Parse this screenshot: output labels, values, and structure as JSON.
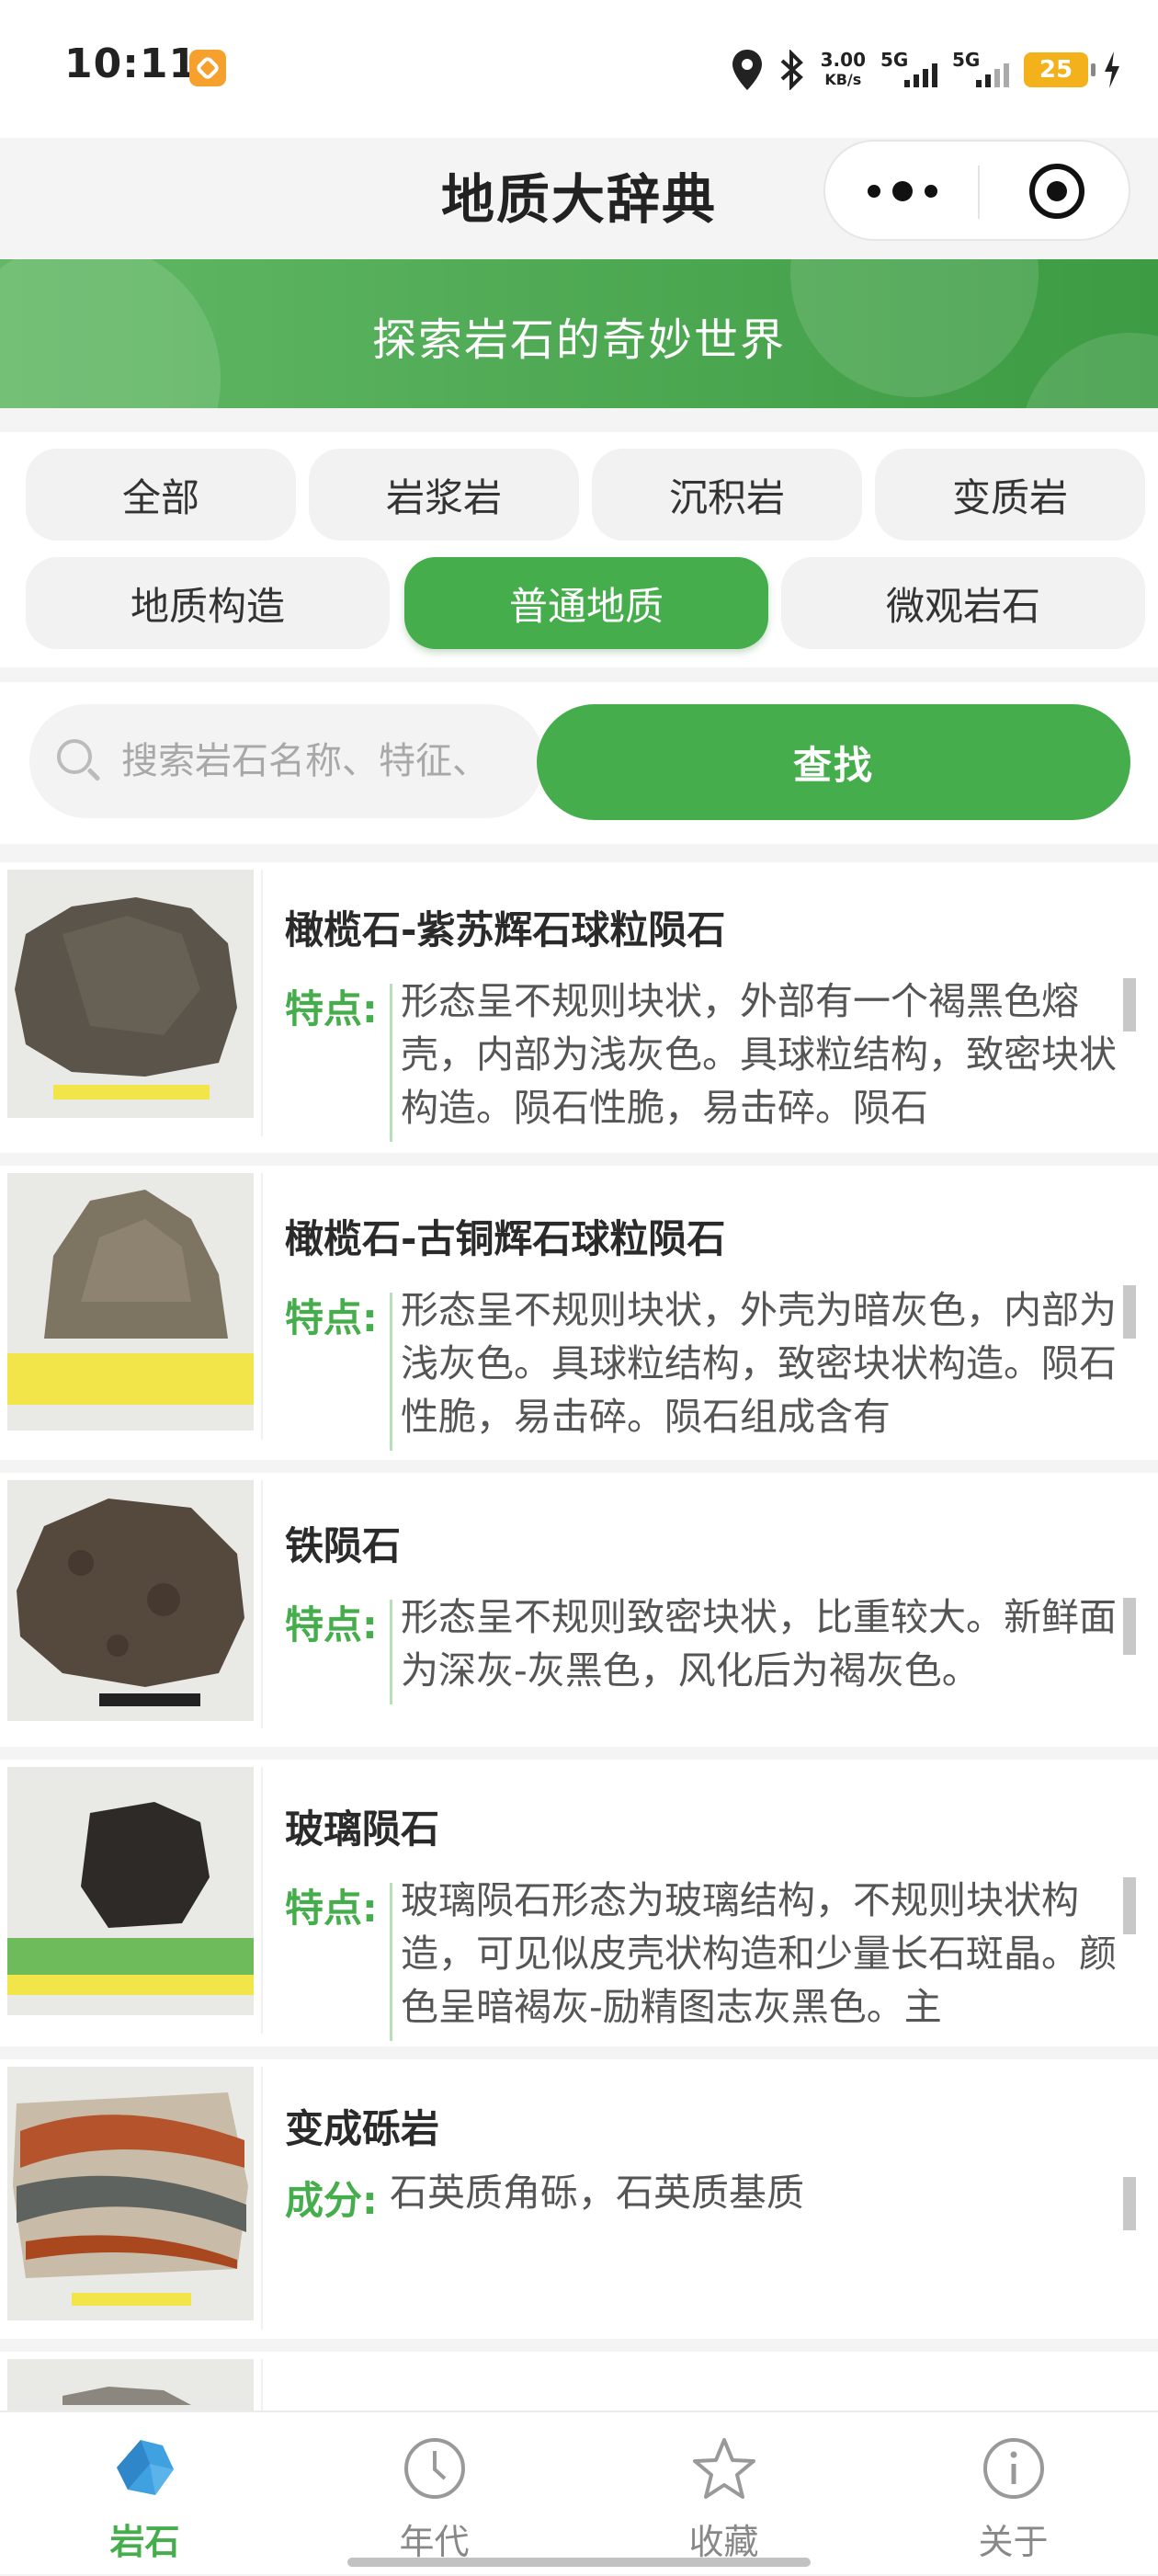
{
  "status_bar": {
    "time": "10:11",
    "net_speed_value": "3.00",
    "net_speed_unit": "KB/s",
    "signal1": "5G",
    "signal2": "5G",
    "battery": "25"
  },
  "nav": {
    "title": "地质大辞典",
    "more_icon": "more-dots-icon",
    "close_icon": "target-icon"
  },
  "banner": {
    "title": "探索岩石的奇妙世界"
  },
  "categories": [
    {
      "label": "全部",
      "active": false
    },
    {
      "label": "岩浆岩",
      "active": false
    },
    {
      "label": "沉积岩",
      "active": false
    },
    {
      "label": "变质岩",
      "active": false
    },
    {
      "label": "地质构造",
      "active": false
    },
    {
      "label": "普通地质",
      "active": true
    },
    {
      "label": "微观岩石",
      "active": false
    }
  ],
  "search": {
    "placeholder": "搜索岩石名称、特征、",
    "button_label": "查找"
  },
  "rocks": [
    {
      "name": "橄榄石-紫苏辉石球粒陨石",
      "label": "特点:",
      "text": "形态呈不规则块状，外部有一个褐黑色熔壳，内部为浅灰色。具球粒结构，致密块状构造。陨石性脆，易击碎。陨石"
    },
    {
      "name": "橄榄石-古铜辉石球粒陨石",
      "label": "特点:",
      "text": "形态呈不规则块状，外壳为暗灰色，内部为浅灰色。具球粒结构，致密块状构造。陨石性脆，易击碎。陨石组成含有"
    },
    {
      "name": "铁陨石",
      "label": "特点:",
      "text": "形态呈不规则致密块状，比重较大。新鲜面为深灰-灰黑色，风化后为褐灰色。"
    },
    {
      "name": "玻璃陨石",
      "label": "特点:",
      "text": "玻璃陨石形态为玻璃结构，不规则块状构造，可见似皮壳状构造和少量长石斑晶。颜色呈暗褐灰-励精图志灰黑色。主"
    },
    {
      "name": "变成砾岩",
      "label": "成分:",
      "text": "石英质角砾，石英质基质"
    }
  ],
  "tabs": [
    {
      "label": "岩石",
      "icon": "rock-icon",
      "active": true
    },
    {
      "label": "年代",
      "icon": "clock-icon",
      "active": false
    },
    {
      "label": "收藏",
      "icon": "star-icon",
      "active": false
    },
    {
      "label": "关于",
      "icon": "info-icon",
      "active": false
    }
  ],
  "colors": {
    "accent": "#45ad4c",
    "banner_start": "#62b865",
    "banner_end": "#3c9b43"
  }
}
